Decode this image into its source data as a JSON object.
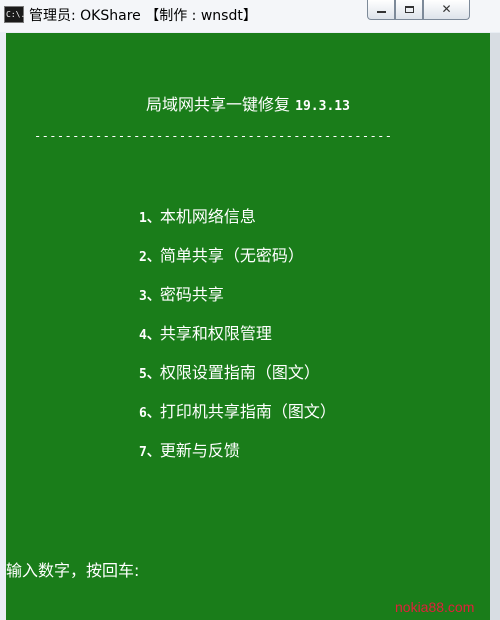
{
  "window": {
    "title": "管理员:  OKShare 【制作 : wnsdt】",
    "icon_label": "C:\\.",
    "controls": {
      "minimize": "minimize-icon",
      "maximize": "maximize-icon",
      "close": "✕"
    }
  },
  "console": {
    "header_title": "局域网共享一键修复",
    "header_version": "19.3.13",
    "divider": "-----------------------------------------------",
    "menu": [
      {
        "num": "1、",
        "label": "本机网络信息"
      },
      {
        "num": "2、",
        "label": "简单共享（无密码）"
      },
      {
        "num": "3、",
        "label": "密码共享"
      },
      {
        "num": "4、",
        "label": "共享和权限管理"
      },
      {
        "num": "5、",
        "label": "权限设置指南（图文）"
      },
      {
        "num": "6、",
        "label": "打印机共享指南（图文）"
      },
      {
        "num": "7、",
        "label": "更新与反馈"
      }
    ],
    "prompt": "输入数字，按回车:"
  },
  "watermark": "nokia88.com",
  "colors": {
    "console_bg": "#1a7d1a",
    "console_text": "#ffffff",
    "watermark": "#e0203a"
  }
}
